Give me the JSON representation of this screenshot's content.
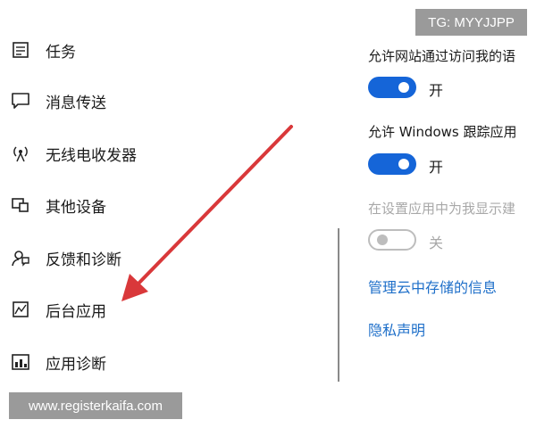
{
  "sidebar": {
    "items": [
      {
        "label": "任务",
        "icon": "task-icon"
      },
      {
        "label": "消息传送",
        "icon": "message-icon"
      },
      {
        "label": "无线电收发器",
        "icon": "radio-icon"
      },
      {
        "label": "其他设备",
        "icon": "devices-icon"
      },
      {
        "label": "反馈和诊断",
        "icon": "feedback-icon"
      },
      {
        "label": "后台应用",
        "icon": "background-apps-icon"
      },
      {
        "label": "应用诊断",
        "icon": "app-diagnostics-icon"
      }
    ]
  },
  "settings": {
    "websites_label": "允许网站通过访问我的语",
    "websites_state": "开",
    "windows_label": "允许 Windows 跟踪应用",
    "windows_state": "开",
    "suggest_label": "在设置应用中为我显示建",
    "suggest_state": "关",
    "cloud_link": "管理云中存储的信息",
    "privacy_link": "隐私声明"
  },
  "watermarks": {
    "tg": "TG: MYYJJPP",
    "url": "www.registerkaifa.com"
  },
  "colors": {
    "accent": "#1565d8",
    "link": "#1e6fc9",
    "arrow": "#d9383a"
  }
}
